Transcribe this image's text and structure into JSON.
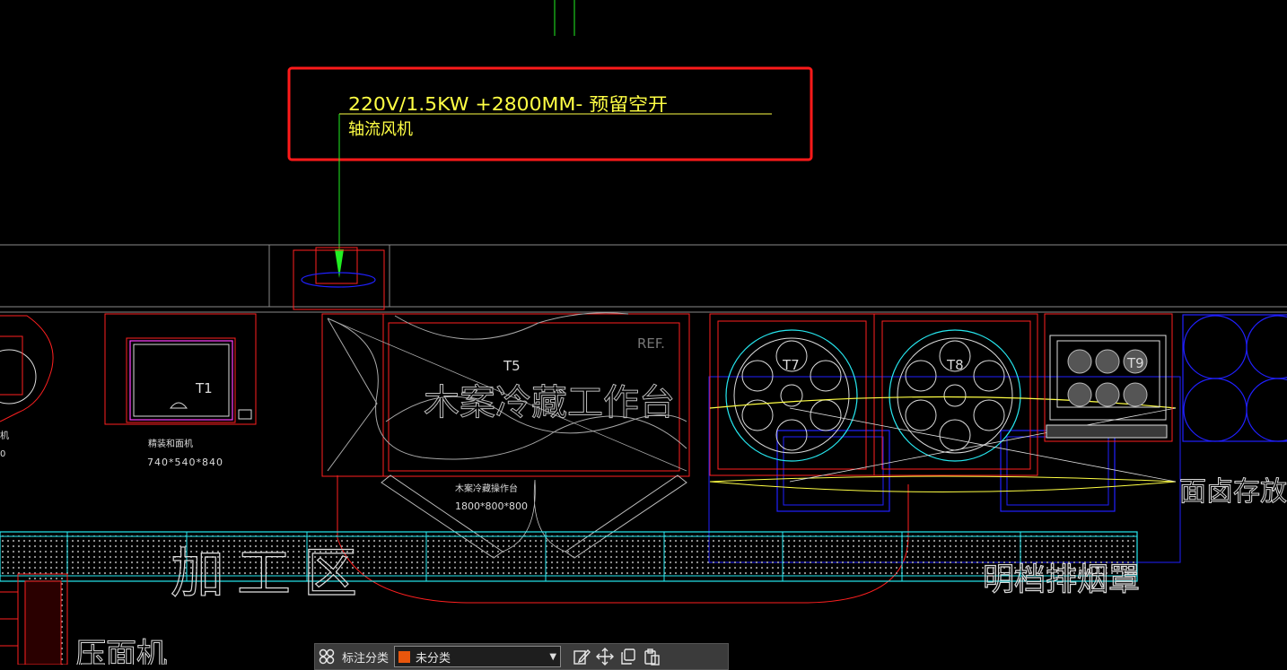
{
  "annotation": {
    "line1": "220V/1.5KW  +2800MM- 预留空开",
    "line2": "轴流风机"
  },
  "labels": {
    "t1": "T1",
    "t5": "T5",
    "t7": "T7",
    "t8": "T8",
    "t9": "T9",
    "ref": "REF.",
    "cold_table_big": "木案冷藏工作台",
    "cold_table_small": "木案冷藏操作台",
    "cold_table_size": "1800*800*800",
    "noodle_machine": "精装和面机",
    "noodle_machine_size": "740*540*840",
    "left_partial_1": "机",
    "left_partial_2": "0",
    "processing_area": "加工区",
    "hood": "明档排烟罩",
    "brine_storage": "面卤存放",
    "press_machine": "压面机"
  },
  "toolbar": {
    "label": "标注分类",
    "selected": "未分类",
    "selected_color": "#e8560c",
    "icons": [
      "category-icon",
      "edit-annotation-icon",
      "move-icon",
      "copy-icon",
      "paste-icon"
    ]
  },
  "colors": {
    "red": "#ff2020",
    "cyan": "#26e8f0",
    "yellow": "#ffff44",
    "blue": "#2020ff",
    "magenta": "#ff40ff",
    "green": "#22ee22",
    "white": "#dcdcdc",
    "grey": "#8a8a8a",
    "highlight": "#ff1a1a"
  }
}
